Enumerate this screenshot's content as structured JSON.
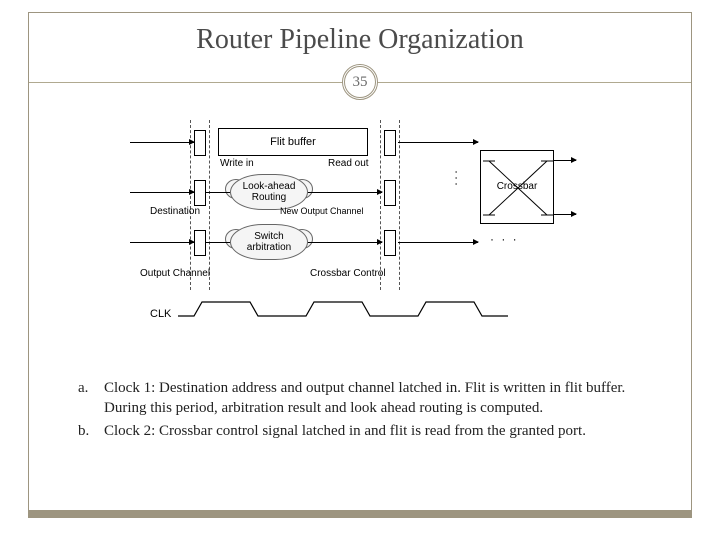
{
  "title": "Router Pipeline Organization",
  "page_number": "35",
  "diagram": {
    "flit_buffer": "Flit buffer",
    "write_in": "Write in",
    "read_out": "Read out",
    "look_ahead": "Look-ahead Routing",
    "destination": "Destination",
    "new_output_channel": "New Output Channel",
    "switch_arb": "Switch arbitration",
    "output_channel": "Output Channel",
    "crossbar_control": "Crossbar Control",
    "crossbar": "Crossbar",
    "clk": "CLK"
  },
  "bullets": {
    "a": "Clock 1: Destination address and output channel latched in. Flit is written in flit buffer. During this period, arbitration result and look ahead routing is computed.",
    "b": "Clock 2: Crossbar control signal latched in and flit is read from the granted port."
  }
}
